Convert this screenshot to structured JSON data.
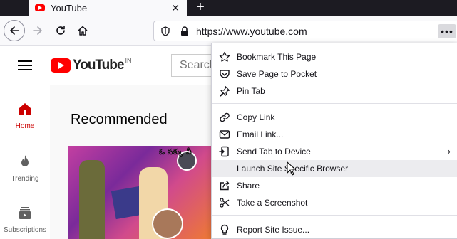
{
  "tab": {
    "title": "YouTube",
    "close_glyph": "✕",
    "favicon": "youtube-favicon"
  },
  "new_tab_glyph": "+",
  "toolbar": {
    "url": "https://www.youtube.com",
    "page_actions_glyph": "•••"
  },
  "youtube": {
    "logo_word": "YouTube",
    "logo_region": "IN",
    "search_placeholder": "Search",
    "guide": [
      {
        "label": "Home",
        "icon": "home-icon"
      },
      {
        "label": "Trending",
        "icon": "fire-icon"
      },
      {
        "label": "Subscriptions",
        "icon": "subscriptions-icon"
      }
    ],
    "shelf_title": "Recommended",
    "thumb_text": "ఓ సక్కు నీ"
  },
  "menu": {
    "items": [
      {
        "label": "Bookmark This Page",
        "icon": "star-icon"
      },
      {
        "label": "Save Page to Pocket",
        "icon": "pocket-icon"
      },
      {
        "label": "Pin Tab",
        "icon": "pin-icon"
      },
      {
        "label": "Copy Link",
        "icon": "link-icon"
      },
      {
        "label": "Email Link...",
        "icon": "email-icon"
      },
      {
        "label": "Send Tab to Device",
        "icon": "send-to-device-icon",
        "chevron": "›"
      },
      {
        "label": "Launch Site Specific Browser",
        "icon": "",
        "hovered": true
      },
      {
        "label": "Share",
        "icon": "share-icon"
      },
      {
        "label": "Take a Screenshot",
        "icon": "screenshot-icon"
      },
      {
        "label": "Report Site Issue...",
        "icon": "bulb-icon"
      }
    ]
  },
  "colors": {
    "tabstrip": "#1c1b22",
    "youtube_red": "#ff0000",
    "active_guide": "#cc0000",
    "menu_hover": "#ececef"
  }
}
